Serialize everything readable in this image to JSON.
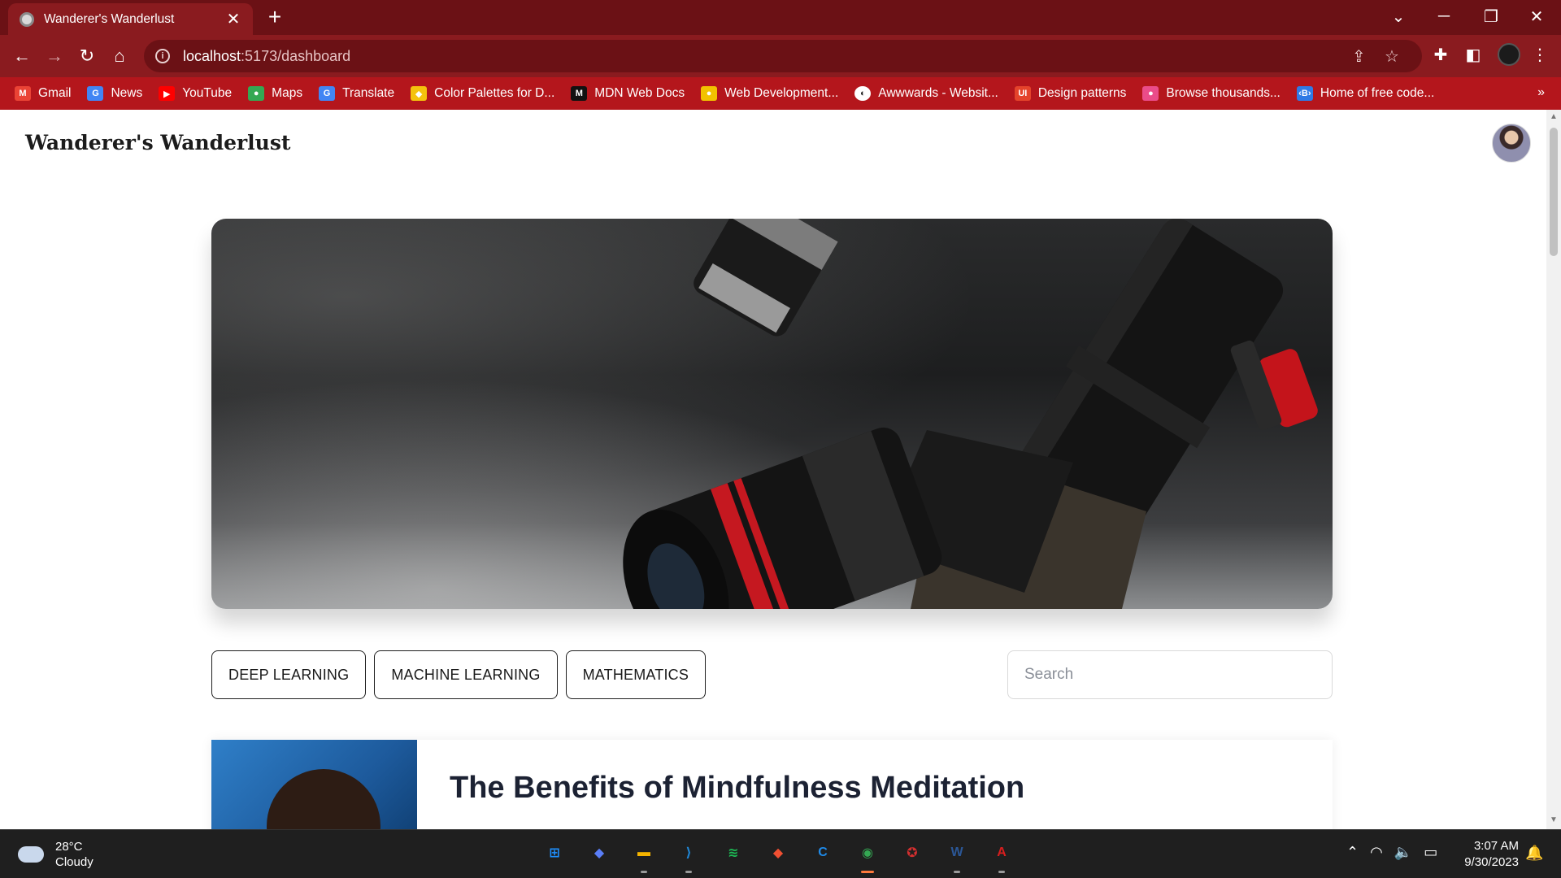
{
  "browser": {
    "tab_title": "Wanderer's Wanderlust",
    "tab_close": "✕",
    "new_tab": "+",
    "url_host": "localhost",
    "url_path": ":5173/dashboard",
    "window_controls": {
      "tabsearch": "⌄",
      "minimize": "─",
      "restore": "❐",
      "close": "✕"
    },
    "bookmarks": [
      {
        "label": "Gmail",
        "icon": "gmail-icon",
        "color": "#ea4335",
        "glyph": "M"
      },
      {
        "label": "News",
        "icon": "news-icon",
        "color": "#4285f4",
        "glyph": "G"
      },
      {
        "label": "YouTube",
        "icon": "youtube-icon",
        "color": "#ff0000",
        "glyph": "▶"
      },
      {
        "label": "Maps",
        "icon": "maps-icon",
        "color": "#34a853",
        "glyph": "●"
      },
      {
        "label": "Translate",
        "icon": "translate-icon",
        "color": "#4285f4",
        "glyph": "G"
      },
      {
        "label": "Color Palettes for D...",
        "icon": "palette-icon",
        "color": "#f4c20d",
        "glyph": "◆"
      },
      {
        "label": "MDN Web Docs",
        "icon": "mdn-icon",
        "color": "#111111",
        "glyph": "M"
      },
      {
        "label": "Web Development...",
        "icon": "webdev-icon",
        "color": "#f2c200",
        "glyph": "●"
      },
      {
        "label": "Awwwards - Websit...",
        "icon": "awwwards-icon",
        "color": "#ffffff",
        "glyph": "◐"
      },
      {
        "label": "Design patterns",
        "icon": "ui-icon",
        "color": "#e4432b",
        "glyph": "UI"
      },
      {
        "label": "Browse thousands...",
        "icon": "dribbble-icon",
        "color": "#ea4c89",
        "glyph": "●"
      },
      {
        "label": "Home of free code...",
        "icon": "code-icon",
        "color": "#2f7ae5",
        "glyph": "‹B›"
      }
    ],
    "bookmarks_more": "»"
  },
  "site": {
    "title": "Wanderer's Wanderlust"
  },
  "filters": [
    {
      "label": "DEEP LEARNING"
    },
    {
      "label": "MACHINE LEARNING"
    },
    {
      "label": "MATHEMATICS"
    }
  ],
  "search": {
    "placeholder": "Search",
    "value": ""
  },
  "post": {
    "title": "The Benefits of Mindfulness Meditation"
  },
  "taskbar": {
    "weather_temp": "28°C",
    "weather_desc": "Cloudy",
    "apps": [
      {
        "name": "windows-start-icon",
        "color": "#1e90ff",
        "glyph": "⊞",
        "running": false
      },
      {
        "name": "copilot-icon",
        "color": "#5a7ef7",
        "glyph": "◆",
        "running": false
      },
      {
        "name": "file-explorer-icon",
        "color": "#f4b400",
        "glyph": "▬",
        "running": true
      },
      {
        "name": "vscode-icon",
        "color": "#1f86d6",
        "glyph": "⟩",
        "running": true
      },
      {
        "name": "spotify-icon",
        "color": "#1db954",
        "glyph": "≋",
        "running": false
      },
      {
        "name": "git-icon",
        "color": "#f05032",
        "glyph": "◆",
        "running": false
      },
      {
        "name": "c-app-icon",
        "color": "#1f8ae8",
        "glyph": "C",
        "running": false
      },
      {
        "name": "chrome-icon",
        "color": "#34a853",
        "glyph": "◉",
        "running": true,
        "active": true
      },
      {
        "name": "red-app-icon",
        "color": "#d32f2f",
        "glyph": "✪",
        "running": false
      },
      {
        "name": "word-icon",
        "color": "#2b5797",
        "glyph": "W",
        "running": true
      },
      {
        "name": "acrobat-icon",
        "color": "#d81e1e",
        "glyph": "A",
        "running": true
      }
    ],
    "time": "3:07 AM",
    "date": "9/30/2023"
  },
  "colors": {
    "tabstrip": "#6b1115",
    "toolbar": "#8a1b1f",
    "bookmarks_bar": "#b4161c"
  }
}
